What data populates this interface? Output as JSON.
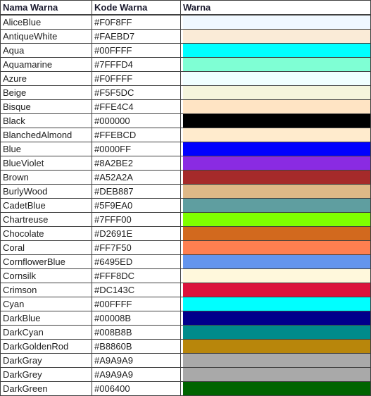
{
  "table": {
    "headers": {
      "name": "Nama Warna",
      "code": "Kode Warna",
      "swatch": "Warna"
    },
    "rows": [
      {
        "name": "AliceBlue",
        "code": "#F0F8FF",
        "hex": "#F0F8FF"
      },
      {
        "name": "AntiqueWhite",
        "code": "#FAEBD7",
        "hex": "#FAEBD7"
      },
      {
        "name": "Aqua",
        "code": "#00FFFF",
        "hex": "#00FFFF"
      },
      {
        "name": "Aquamarine",
        "code": "#7FFFD4",
        "hex": "#7FFFD4"
      },
      {
        "name": "Azure",
        "code": "#F0FFFF",
        "hex": "#F0FFFF"
      },
      {
        "name": "Beige",
        "code": "#F5F5DC",
        "hex": "#F5F5DC"
      },
      {
        "name": "Bisque",
        "code": "#FFE4C4",
        "hex": "#FFE4C4"
      },
      {
        "name": "Black",
        "code": "#000000",
        "hex": "#000000"
      },
      {
        "name": "BlanchedAlmond",
        "code": "#FFEBCD",
        "hex": "#FFEBCD"
      },
      {
        "name": "Blue",
        "code": "#0000FF",
        "hex": "#0000FF"
      },
      {
        "name": "BlueViolet",
        "code": "#8A2BE2",
        "hex": "#8A2BE2"
      },
      {
        "name": "Brown",
        "code": "#A52A2A",
        "hex": "#A52A2A"
      },
      {
        "name": "BurlyWood",
        "code": "#DEB887",
        "hex": "#DEB887"
      },
      {
        "name": "CadetBlue",
        "code": "#5F9EA0",
        "hex": "#5F9EA0"
      },
      {
        "name": "Chartreuse",
        "code": "#7FFF00",
        "hex": "#7FFF00"
      },
      {
        "name": "Chocolate",
        "code": "#D2691E",
        "hex": "#D2691E"
      },
      {
        "name": "Coral",
        "code": "#FF7F50",
        "hex": "#FF7F50"
      },
      {
        "name": "CornflowerBlue",
        "code": "#6495ED",
        "hex": "#6495ED"
      },
      {
        "name": "Cornsilk",
        "code": "#FFF8DC",
        "hex": "#FFF8DC"
      },
      {
        "name": "Crimson",
        "code": "#DC143C",
        "hex": "#DC143C"
      },
      {
        "name": "Cyan",
        "code": "#00FFFF",
        "hex": "#00FFFF"
      },
      {
        "name": "DarkBlue",
        "code": "#00008B",
        "hex": "#00008B"
      },
      {
        "name": "DarkCyan",
        "code": "#008B8B",
        "hex": "#008B8B"
      },
      {
        "name": "DarkGoldenRod",
        "code": "#B8860B",
        "hex": "#B8860B"
      },
      {
        "name": "DarkGray",
        "code": "#A9A9A9",
        "hex": "#A9A9A9"
      },
      {
        "name": "DarkGrey",
        "code": "#A9A9A9",
        "hex": "#A9A9A9"
      },
      {
        "name": "DarkGreen",
        "code": "#006400",
        "hex": "#006400"
      }
    ]
  }
}
